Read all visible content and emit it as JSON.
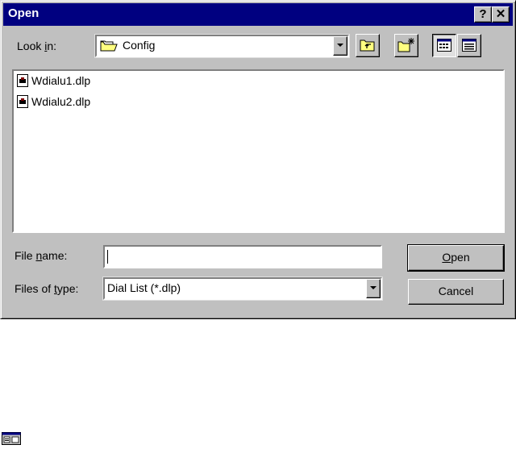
{
  "dialog": {
    "title": "Open",
    "help_glyph": "?",
    "close_glyph": "✕"
  },
  "look_in": {
    "label_pre": "Look ",
    "label_accel": "i",
    "label_post": "n:",
    "value": "Config",
    "icon": "folder-icon"
  },
  "toolbar": {
    "up_folder_icon": "up-one-level-icon",
    "new_folder_icon": "new-folder-icon",
    "list_view_icon": "list-view-icon",
    "details_view_icon": "details-view-icon"
  },
  "files": [
    {
      "name": "Wdialu1.dlp",
      "icon": "dial-list-file-icon"
    },
    {
      "name": "Wdialu2.dlp",
      "icon": "dial-list-file-icon"
    }
  ],
  "file_name": {
    "label_pre": "File ",
    "label_accel": "n",
    "label_post": "ame:",
    "value": ""
  },
  "file_type": {
    "label_pre": "Files of ",
    "label_accel": "t",
    "label_post": "ype:",
    "value": "Dial List (*.dlp)"
  },
  "buttons": {
    "open_accel": "O",
    "open_rest": "pen",
    "cancel": "Cancel"
  },
  "colors": {
    "titlebar": "#000080",
    "face": "#c0c0c0"
  }
}
